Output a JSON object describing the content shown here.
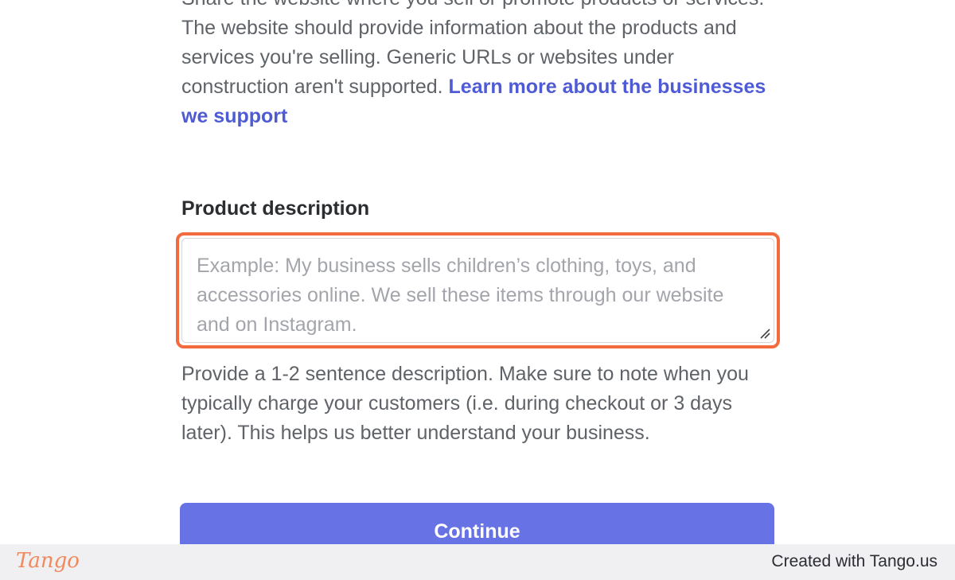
{
  "website_help": {
    "text": "Share the website where you sell or promote products or services. The website should provide information about the products and services you're selling. Generic URLs or websites under construction aren't supported.",
    "link": "Learn more about the businesses we support"
  },
  "product_description": {
    "label": "Product description",
    "placeholder": "Example: My business sells children’s clothing, toys, and accessories online. We sell these items through our website and on Instagram.",
    "value": "",
    "help": "Provide a 1-2 sentence description. Make sure to note when you typically charge your customers (i.e. during checkout or 3 days later). This helps us better understand your business."
  },
  "actions": {
    "continue_label": "Continue"
  },
  "footer": {
    "logo": "Tango",
    "credit": "Created with Tango.us"
  },
  "colors": {
    "accent": "#6772e5",
    "link": "#4f5bd5",
    "highlight": "#f26a3d"
  }
}
